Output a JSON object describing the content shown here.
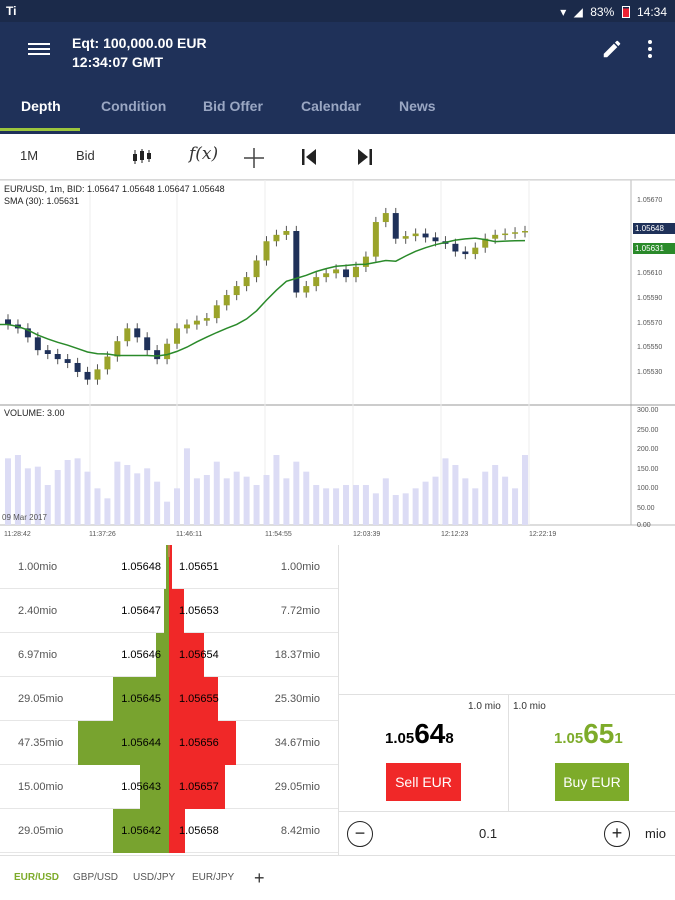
{
  "status_bar": {
    "left": "Ti",
    "battery": "83%",
    "time": "14:34"
  },
  "header": {
    "equity": "Eqt: 100,000.00 EUR",
    "time": "12:34:07 GMT"
  },
  "tabs": [
    "Depth",
    "Condition",
    "Bid Offer",
    "Calendar",
    "News"
  ],
  "toolbar": {
    "timeframe": "1M",
    "price_type": "Bid",
    "func_icon": "f(x)"
  },
  "chart": {
    "legend_line1": "EUR/USD, 1m, BID: 1.05647 1.05648 1.05647 1.05648",
    "legend_line2": "SMA (30): 1.05631",
    "volume_label": "VOLUME: 3.00",
    "date_label": "09 Mar 2017",
    "price_tag_bid": "1.05648",
    "price_tag_sma": "1.05631",
    "price_axis": [
      "1.05670",
      "1.05650",
      "1.05610",
      "1.05590",
      "1.05570",
      "1.05550",
      "1.05530"
    ],
    "volume_axis": [
      "300.00",
      "250.00",
      "200.00",
      "150.00",
      "100.00",
      "50.00",
      "0.00"
    ],
    "time_axis": [
      "11:28:42",
      "11:37:26",
      "11:46:11",
      "11:54:55",
      "12:03:39",
      "12:12:23",
      "12:22:19"
    ],
    "colors": {
      "bull": "#9aa32a",
      "bear": "#1f3159",
      "sma": "#2a8a2a",
      "volume": "#dcdcf5"
    }
  },
  "chart_data": {
    "type": "candlestick",
    "title": "EUR/USD, 1m, BID",
    "candles_close_approx": [
      1.05575,
      1.05572,
      1.05565,
      1.05555,
      1.05552,
      1.05548,
      1.05545,
      1.05538,
      1.05532,
      1.0554,
      1.0555,
      1.05562,
      1.05572,
      1.05565,
      1.05555,
      1.05548,
      1.0556,
      1.05572,
      1.05575,
      1.05578,
      1.0558,
      1.0559,
      1.05598,
      1.05605,
      1.05612,
      1.05625,
      1.0564,
      1.05645,
      1.05648,
      1.056,
      1.05605,
      1.05612,
      1.05615,
      1.05618,
      1.05612,
      1.0562,
      1.05628,
      1.05655,
      1.05662,
      1.05642,
      1.05644,
      1.05646,
      1.05643,
      1.0564,
      1.05638,
      1.05632,
      1.0563,
      1.05635,
      1.05642,
      1.05645,
      1.05646,
      1.05647,
      1.05648
    ],
    "sma_value": 1.05631,
    "volume_approx": [
      200,
      210,
      170,
      175,
      120,
      165,
      195,
      200,
      160,
      110,
      80,
      190,
      180,
      155,
      170,
      130,
      70,
      110,
      230,
      140,
      150,
      190,
      140,
      160,
      145,
      120,
      150,
      210,
      140,
      190,
      160,
      120,
      110,
      110,
      120,
      120,
      120,
      95,
      140,
      90,
      95,
      110,
      130,
      145,
      200,
      180,
      140,
      110,
      160,
      180,
      145,
      110,
      210
    ],
    "ylim": [
      1.0552,
      1.0568
    ]
  },
  "depth": {
    "rows": [
      {
        "bid_qty": "1.00mio",
        "bid": "1.05648",
        "ask": "1.05651",
        "ask_qty": "1.00mio",
        "bid_vol": 1.0,
        "ask_vol": 1.0
      },
      {
        "bid_qty": "2.40mio",
        "bid": "1.05647",
        "ask": "1.05653",
        "ask_qty": "7.72mio",
        "bid_vol": 2.4,
        "ask_vol": 7.72
      },
      {
        "bid_qty": "6.97mio",
        "bid": "1.05646",
        "ask": "1.05654",
        "ask_qty": "18.37mio",
        "bid_vol": 6.97,
        "ask_vol": 18.37
      },
      {
        "bid_qty": "29.05mio",
        "bid": "1.05645",
        "ask": "1.05655",
        "ask_qty": "25.30mio",
        "bid_vol": 29.05,
        "ask_vol": 25.3
      },
      {
        "bid_qty": "47.35mio",
        "bid": "1.05644",
        "ask": "1.05656",
        "ask_qty": "34.67mio",
        "bid_vol": 47.35,
        "ask_vol": 34.67
      },
      {
        "bid_qty": "15.00mio",
        "bid": "1.05643",
        "ask": "1.05657",
        "ask_qty": "29.05mio",
        "bid_vol": 15.0,
        "ask_vol": 29.05
      },
      {
        "bid_qty": "29.05mio",
        "bid": "1.05642",
        "ask": "1.05658",
        "ask_qty": "8.42mio",
        "bid_vol": 29.05,
        "ask_vol": 8.42
      }
    ]
  },
  "trade": {
    "sell_qty": "1.0 mio",
    "buy_qty": "1.0 mio",
    "sell_price": {
      "small": "1.05",
      "big": "64",
      "tail": "8"
    },
    "buy_price": {
      "small": "1.05",
      "big": "65",
      "tail": "1"
    },
    "sell_label": "Sell EUR",
    "buy_label": "Buy EUR",
    "amount": "0.1",
    "unit": "mio"
  },
  "pairs": [
    "EUR/USD",
    "GBP/USD",
    "USD/JPY",
    "EUR/JPY"
  ]
}
